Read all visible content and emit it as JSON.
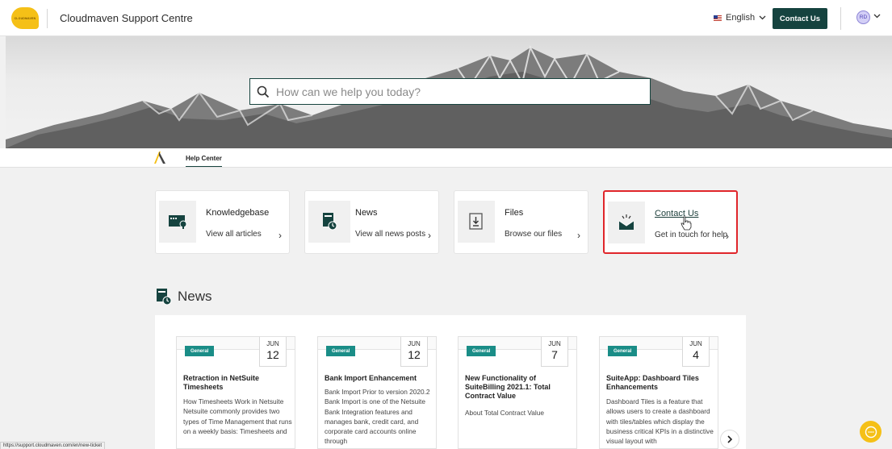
{
  "header": {
    "logo_text": "CLOUDMAVEN",
    "site_title": "Cloudmaven Support Centre",
    "language": "English",
    "contact_button": "Contact Us",
    "avatar_initials": "RD"
  },
  "search": {
    "placeholder": "How can we help you today?"
  },
  "tabs": {
    "help_center": "Help Center"
  },
  "quick_links": [
    {
      "title": "Knowledgebase",
      "subtitle": "View all articles",
      "icon": "knowledgebase-icon"
    },
    {
      "title": "News",
      "subtitle": "View all news posts",
      "icon": "news-icon"
    },
    {
      "title": "Files",
      "subtitle": "Browse our files",
      "icon": "download-file-icon"
    },
    {
      "title": "Contact Us",
      "subtitle": "Get in touch for help",
      "icon": "envelope-icon",
      "highlighted": true
    }
  ],
  "news": {
    "heading": "News",
    "items": [
      {
        "tag": "General",
        "month": "JUN",
        "day": "12",
        "title": "Retraction in NetSuite Timesheets",
        "body": "How Timesheets Work in Netsuite Netsuite commonly provides two types of Time Management that runs on a weekly basis: Timesheets and"
      },
      {
        "tag": "General",
        "month": "JUN",
        "day": "12",
        "title": "Bank Import Enhancement",
        "body": "Bank Import Prior to version 2020.2 Bank Import is one of the Netsuite Bank Integration features and manages bank, credit card, and corporate card accounts online through"
      },
      {
        "tag": "General",
        "month": "JUN",
        "day": "7",
        "title": "New Functionality of SuiteBilling 2021.1: Total Contract Value",
        "body": "About Total Contract Value"
      },
      {
        "tag": "General",
        "month": "JUN",
        "day": "4",
        "title": "SuiteApp: Dashboard Tiles Enhancements",
        "body": "Dashboard Tiles is a feature that allows users to create a dashboard with tiles/tables which display the business critical KPIs in a distinctive visual layout with"
      }
    ]
  },
  "status_url": "https://support.cloudmaven.com/en/new-ticket",
  "colors": {
    "brand_dark": "#15433f",
    "accent_yellow": "#f5c017",
    "tag_teal": "#1a8d87",
    "highlight_red": "#e0262b"
  }
}
